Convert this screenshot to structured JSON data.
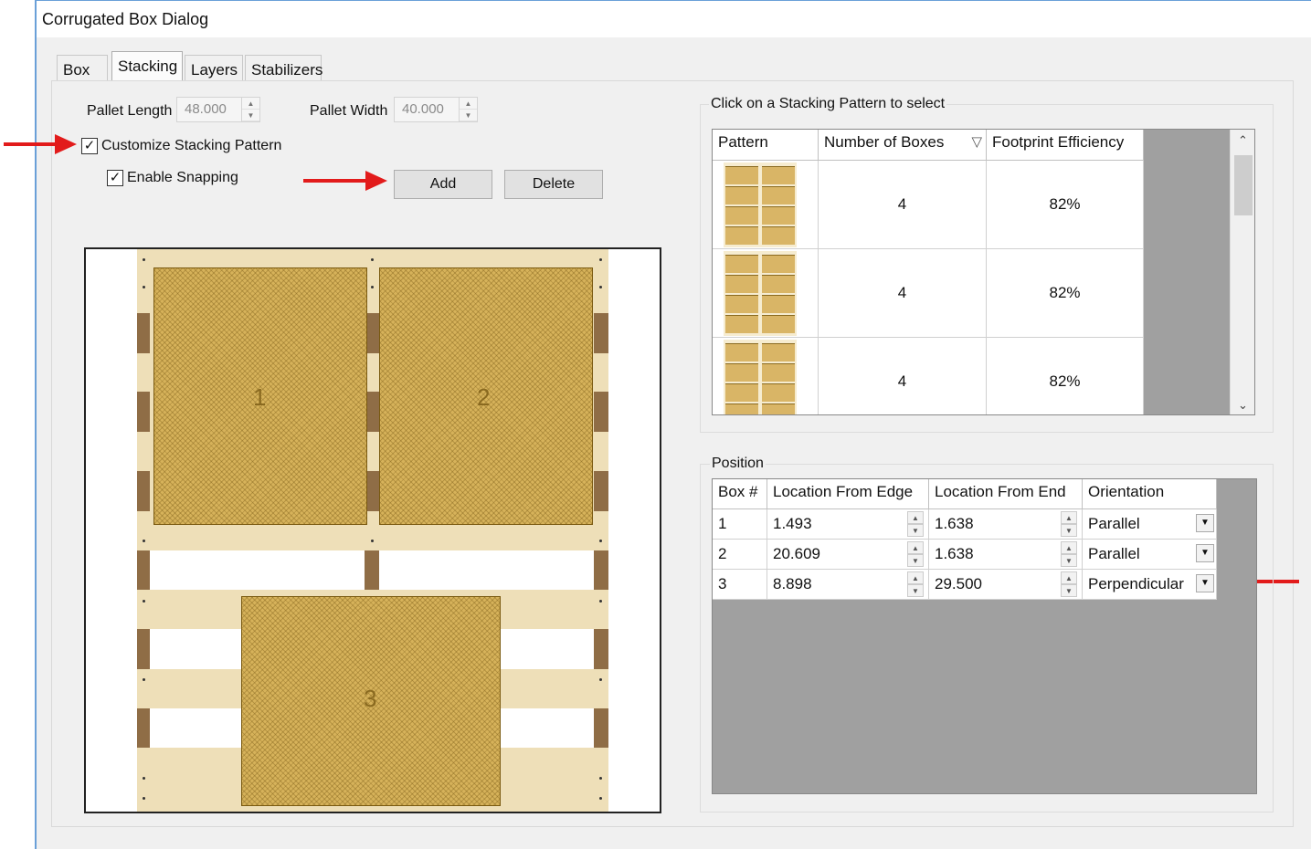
{
  "window": {
    "title": "Corrugated Box Dialog"
  },
  "tabs": [
    {
      "label": "Box",
      "active": false
    },
    {
      "label": "Stacking",
      "active": true
    },
    {
      "label": "Layers",
      "active": false
    },
    {
      "label": "Stabilizers",
      "active": false
    }
  ],
  "pallet": {
    "length_label": "Pallet Length",
    "length_value": "48.000",
    "width_label": "Pallet Width",
    "width_value": "40.000"
  },
  "options": {
    "customize_label": "Customize Stacking Pattern",
    "customize_checked": true,
    "snapping_label": "Enable Snapping",
    "snapping_checked": true
  },
  "buttons": {
    "add": "Add",
    "delete": "Delete"
  },
  "preview": {
    "box_labels": [
      "1",
      "2",
      "3"
    ]
  },
  "patterns": {
    "group_title": "Click on a Stacking Pattern to select",
    "columns": [
      "Pattern",
      "Number of Boxes",
      "Footprint Efficiency"
    ],
    "rows": [
      {
        "num_boxes": "4",
        "efficiency": "82%"
      },
      {
        "num_boxes": "4",
        "efficiency": "82%"
      },
      {
        "num_boxes": "4",
        "efficiency": "82%"
      }
    ]
  },
  "position": {
    "group_title": "Position",
    "columns": [
      "Box #",
      "Location From Edge",
      "Location From End",
      "Orientation"
    ],
    "rows": [
      {
        "box": "1",
        "edge": "1.493",
        "end": "1.638",
        "orientation": "Parallel"
      },
      {
        "box": "2",
        "edge": "20.609",
        "end": "1.638",
        "orientation": "Parallel"
      },
      {
        "box": "3",
        "edge": "8.898",
        "end": "29.500",
        "orientation": "Perpendicular"
      }
    ]
  },
  "icons": {
    "checkmark": "check-icon",
    "annotation_arrow": "red-arrow-icon",
    "dropdown": "chevron-down-icon",
    "sort": "sort-triangle-icon"
  },
  "colors": {
    "annotation_red": "#e21b1b",
    "pallet_deck": "#eedfb8",
    "pallet_stringer": "#8f6d46",
    "box_fill": "#d6b25a",
    "grid_background": "#a0a0a0"
  }
}
